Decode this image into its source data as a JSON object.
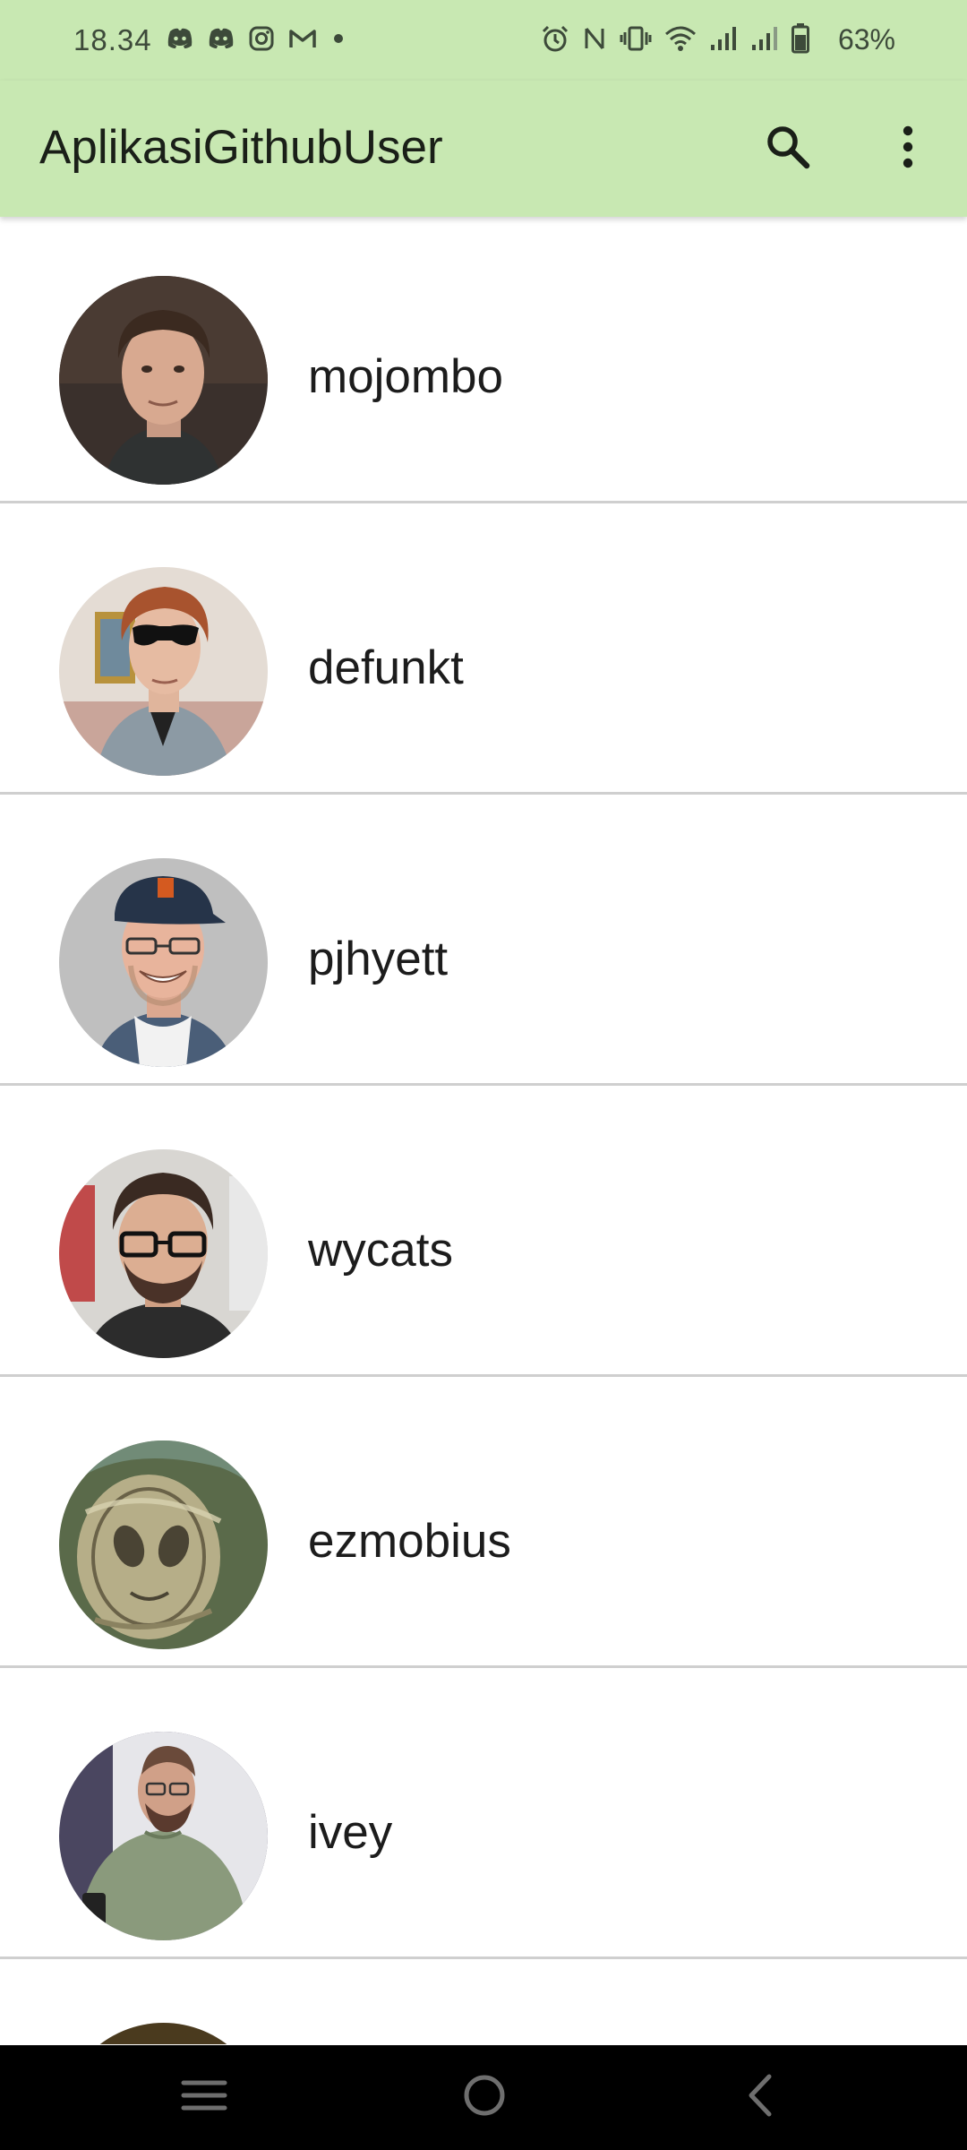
{
  "status_bar": {
    "time": "18.34",
    "battery_percent": "63%",
    "left_icons": [
      "discord-icon",
      "discord-icon",
      "instagram-icon",
      "gmail-icon",
      "dot-icon"
    ],
    "right_icons": [
      "alarm-icon",
      "nfc-icon",
      "vibrate-icon",
      "wifi-icon",
      "signal-icon",
      "signal-icon",
      "battery-icon"
    ]
  },
  "app_bar": {
    "title": "AplikasiGithubUser",
    "background": "#c8e8b2",
    "actions": [
      "search-icon",
      "more-vert-icon"
    ]
  },
  "users": [
    {
      "login": "mojombo"
    },
    {
      "login": "defunkt"
    },
    {
      "login": "pjhyett"
    },
    {
      "login": "wycats"
    },
    {
      "login": "ezmobius"
    },
    {
      "login": "ivey"
    }
  ],
  "nav_bar": {
    "buttons": [
      "recents-icon",
      "home-icon",
      "back-icon"
    ]
  }
}
